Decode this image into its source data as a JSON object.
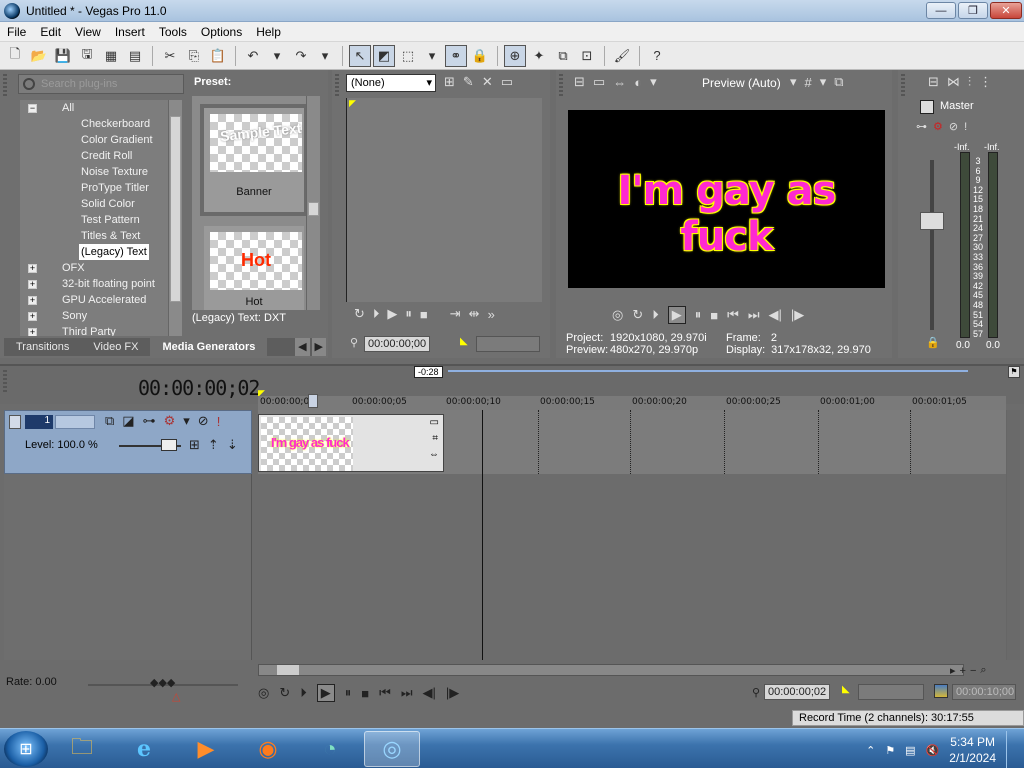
{
  "window": {
    "title": "Untitled * - Vegas Pro 11.0"
  },
  "menu": [
    "File",
    "Edit",
    "View",
    "Insert",
    "Tools",
    "Options",
    "Help"
  ],
  "explorer": {
    "search_placeholder": "Search plug-ins",
    "preset_label": "Preset:",
    "tree": [
      {
        "label": "All",
        "expander": "−"
      },
      {
        "label": "Checkerboard"
      },
      {
        "label": "Color Gradient"
      },
      {
        "label": "Credit Roll"
      },
      {
        "label": "Noise Texture"
      },
      {
        "label": "ProType Titler"
      },
      {
        "label": "Solid Color"
      },
      {
        "label": "Test Pattern"
      },
      {
        "label": "Titles & Text"
      },
      {
        "label": "(Legacy) Text",
        "selected": true
      },
      {
        "label": "OFX",
        "expander": "+"
      },
      {
        "label": "32-bit floating point",
        "expander": "+"
      },
      {
        "label": "GPU Accelerated",
        "expander": "+"
      },
      {
        "label": "Sony",
        "expander": "+"
      },
      {
        "label": "Third Party",
        "expander": "+"
      }
    ],
    "presets": [
      {
        "thumb_text": "Sample Text",
        "caption": "Banner"
      },
      {
        "thumb_text": "Hot",
        "caption": "Hot"
      }
    ],
    "footer": "(Legacy) Text: DXT",
    "tabs": [
      "Transitions",
      "Video FX",
      "Media Generators"
    ],
    "active_tab": "Media Generators"
  },
  "trimmer": {
    "select_value": "(None)",
    "timecode": "00:00:00;00"
  },
  "preview": {
    "mode_label": "Preview (Auto)",
    "video_text": "I'm gay as fuck",
    "project_label": "Project:",
    "project_value": "1920x1080, 29.970i",
    "preview_label": "Preview:",
    "preview_value": "480x270, 29.970p",
    "frame_label": "Frame:",
    "frame_value": "2",
    "display_label": "Display:",
    "display_value": "317x178x32, 29.970"
  },
  "mixer": {
    "title": "Master",
    "inf_left": "-Inf.",
    "inf_right": "-Inf.",
    "scale": [
      "3",
      "6",
      "9",
      "12",
      "15",
      "18",
      "21",
      "24",
      "27",
      "30",
      "33",
      "36",
      "39",
      "42",
      "45",
      "48",
      "51",
      "54",
      "57"
    ],
    "zero_left": "0.0",
    "zero_right": "0.0"
  },
  "timeline": {
    "cursor_time": "00:00:00;02",
    "marker": "-0:28",
    "ruler": [
      "00:00:00;00",
      "00:00:00;05",
      "00:00:00;10",
      "00:00:00;15",
      "00:00:00;20",
      "00:00:00;25",
      "00:00:01;00",
      "00:00:01;05"
    ],
    "track_number": "1",
    "track_level": "Level: 100.0 %",
    "event_text": "I'm gay as fuck",
    "rate": "Rate: 0.00",
    "transport_time": "00:00:00;02",
    "transport_end": "00:00:10;00",
    "record_time": "Record Time (2 channels): 30:17:55"
  },
  "taskbar": {
    "time": "5:34 PM",
    "date": "2/1/2024"
  },
  "colors": {
    "title_text": "#ff29d0",
    "title_outline": "#ffff00",
    "track_header": "#8ea7c7"
  }
}
